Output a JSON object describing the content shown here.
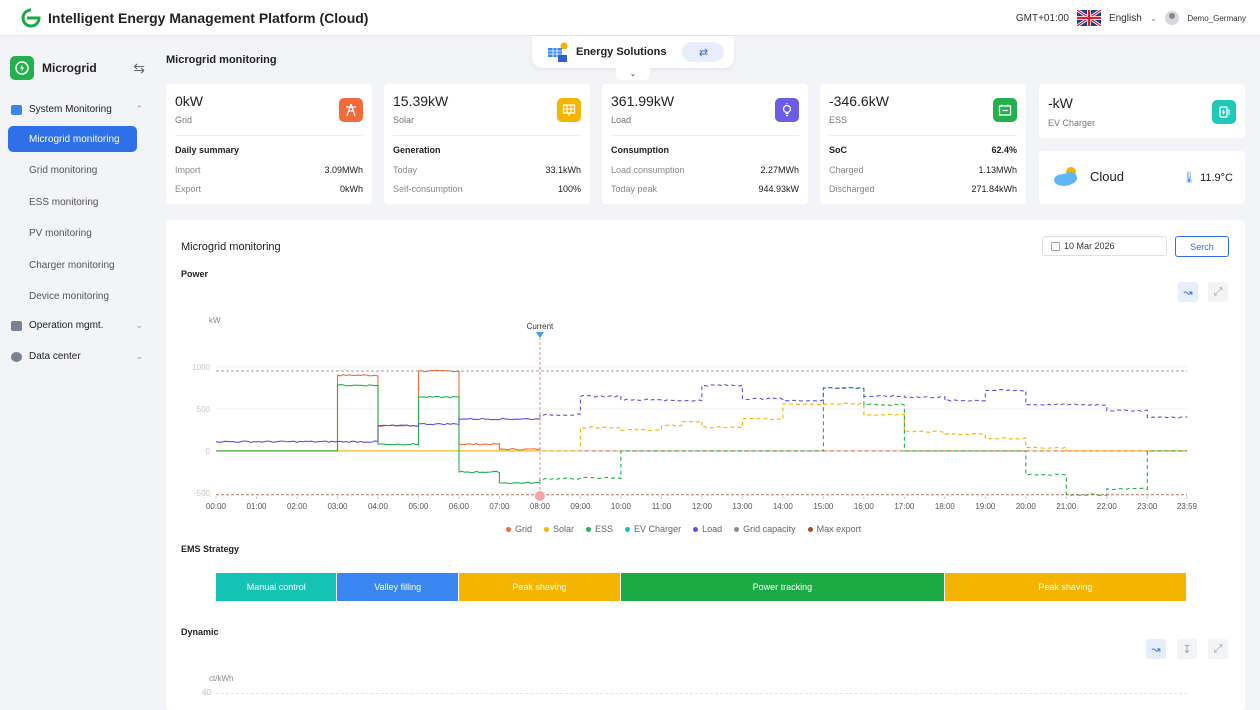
{
  "app": {
    "title": "Intelligent Energy Management Platform (Cloud)"
  },
  "topbar": {
    "timezone": "GMT+01:00",
    "language": "English",
    "user": "Demo_Germany"
  },
  "sidebar": {
    "title": "Microgrid",
    "groups": [
      {
        "label": "System Monitoring",
        "expanded": true
      },
      {
        "label": "Operation mgmt.",
        "expanded": false
      },
      {
        "label": "Data center",
        "expanded": false
      }
    ],
    "items": [
      {
        "label": "Microgrid monitoring",
        "active": true
      },
      {
        "label": "Grid monitoring"
      },
      {
        "label": "ESS monitoring"
      },
      {
        "label": "PV monitoring"
      },
      {
        "label": "Charger monitoring"
      },
      {
        "label": "Device monitoring"
      }
    ]
  },
  "main": {
    "page_title": "Microgrid monitoring",
    "energy_solutions": {
      "label": "Energy Solutions"
    },
    "cards": [
      {
        "value": "0kW",
        "label": "Grid",
        "section": "Daily summary",
        "icon": "grid-tower-icon",
        "color": "#f26b3a",
        "rows": [
          {
            "k": "Import",
            "v": "3.09MWh"
          },
          {
            "k": "Export",
            "v": "0kWh"
          }
        ]
      },
      {
        "value": "15.39kW",
        "label": "Solar",
        "section": "Generation",
        "icon": "solar-panel-icon",
        "color": "#f5b400",
        "rows": [
          {
            "k": "Today",
            "v": "33.1kWh"
          },
          {
            "k": "Self-consumption",
            "v": "100%"
          }
        ]
      },
      {
        "value": "361.99kW",
        "label": "Load",
        "section": "Consumption",
        "icon": "light-bulb-icon",
        "color": "#6c5ce7",
        "rows": [
          {
            "k": "Load consumption",
            "v": "2.27MWh"
          },
          {
            "k": "Today peak",
            "v": "944.93kW"
          }
        ]
      },
      {
        "value": "-346.6kW",
        "label": "ESS",
        "section": "SoC",
        "section_value": "62.4%",
        "icon": "battery-icon",
        "color": "#22b14c",
        "rows": [
          {
            "k": "Charged",
            "v": "1.13MWh"
          },
          {
            "k": "Discharged",
            "v": "271.84kWh"
          }
        ]
      },
      {
        "value": "-kW",
        "label": "EV Charger",
        "icon": "ev-charger-icon",
        "color": "#1fc8b8"
      }
    ],
    "weather": {
      "condition": "Cloud",
      "temperature": "11.9°C"
    },
    "panel": {
      "title": "Microgrid monitoring",
      "date": "10 Mar 2026",
      "search_label": "Serch",
      "power_label": "Power",
      "ems_label": "EMS Strategy",
      "dynamic_label": "Dynamic",
      "dynamic_unit": "ct/kWh",
      "dynamic_tick": "40"
    }
  },
  "chart_data": {
    "type": "line",
    "ylabel": "kW",
    "x": [
      "00:00",
      "01:00",
      "02:00",
      "03:00",
      "04:00",
      "05:00",
      "06:00",
      "07:00",
      "08:00",
      "09:00",
      "10:00",
      "11:00",
      "12:00",
      "13:00",
      "14:00",
      "15:00",
      "16:00",
      "17:00",
      "18:00",
      "19:00",
      "20:00",
      "21:00",
      "22:00",
      "23:00",
      "23:59"
    ],
    "ylim": [
      -500,
      1200
    ],
    "y_ticks": [
      "1000",
      "500",
      "0",
      "-500"
    ],
    "marker": {
      "label": "Current",
      "x": "08:00"
    },
    "series": [
      {
        "name": "Grid",
        "color": "#f26b3a",
        "steps": [
          [
            0,
            0
          ],
          [
            3,
            900
          ],
          [
            4,
            300
          ],
          [
            5,
            950
          ],
          [
            6,
            80
          ],
          [
            7,
            20
          ],
          [
            8,
            0
          ],
          [
            20,
            0
          ]
        ]
      },
      {
        "name": "Solar",
        "color": "#f5b400",
        "steps": [
          [
            0,
            0
          ],
          [
            8,
            0
          ],
          [
            9,
            280
          ],
          [
            10,
            250
          ],
          [
            11,
            300
          ],
          [
            11.5,
            350
          ],
          [
            12,
            280
          ],
          [
            13,
            380
          ],
          [
            14,
            560
          ],
          [
            15,
            560
          ],
          [
            16,
            430
          ],
          [
            17,
            230
          ],
          [
            18,
            200
          ],
          [
            19,
            150
          ],
          [
            20,
            40
          ],
          [
            21,
            0
          ],
          [
            23.98,
            0
          ]
        ]
      },
      {
        "name": "ESS",
        "color": "#22b14c",
        "steps": [
          [
            0,
            0
          ],
          [
            3,
            780
          ],
          [
            4,
            80
          ],
          [
            5,
            640
          ],
          [
            6,
            -250
          ],
          [
            7,
            -380
          ],
          [
            8,
            -330
          ],
          [
            9,
            -320
          ],
          [
            10,
            0
          ],
          [
            15,
            750
          ],
          [
            16,
            550
          ],
          [
            17,
            0
          ],
          [
            20,
            -280
          ],
          [
            21,
            -520
          ],
          [
            22,
            -450
          ],
          [
            23,
            0
          ],
          [
            23.98,
            0
          ]
        ]
      },
      {
        "name": "EV Charger",
        "color": "#1fb8c8",
        "steps": [
          [
            0,
            0
          ],
          [
            23.98,
            0
          ]
        ]
      },
      {
        "name": "Load",
        "color": "#5a55e0",
        "steps": [
          [
            0,
            110
          ],
          [
            3,
            110
          ],
          [
            4,
            300
          ],
          [
            5,
            320
          ],
          [
            6,
            380
          ],
          [
            8,
            430
          ],
          [
            9,
            650
          ],
          [
            10,
            610
          ],
          [
            11,
            600
          ],
          [
            12,
            780
          ],
          [
            13,
            620
          ],
          [
            14,
            600
          ],
          [
            15,
            750
          ],
          [
            16,
            650
          ],
          [
            17,
            640
          ],
          [
            18,
            600
          ],
          [
            19,
            720
          ],
          [
            20,
            550
          ],
          [
            22,
            480
          ],
          [
            23,
            400
          ],
          [
            23.98,
            400
          ]
        ]
      },
      {
        "name": "Grid capacity",
        "color": "#8a8a8a",
        "steps": [
          [
            0,
            950
          ],
          [
            23.98,
            950
          ]
        ]
      },
      {
        "name": "Max export",
        "color": "#a0522d",
        "steps": [
          [
            0,
            -520
          ],
          [
            23.98,
            -520
          ]
        ]
      }
    ],
    "ems_strategy": [
      {
        "label": "Manual control",
        "start": 0,
        "end": 3,
        "color": "#14c3b4"
      },
      {
        "label": "Valley filling",
        "start": 3,
        "end": 6,
        "color": "#3a86f0"
      },
      {
        "label": "Peak shaving",
        "start": 6,
        "end": 10,
        "color": "#f5b400"
      },
      {
        "label": "Power tracking",
        "start": 10,
        "end": 18,
        "color": "#1aab45"
      },
      {
        "label": "Peak shaving",
        "start": 18,
        "end": 23.98,
        "color": "#f5b400"
      }
    ]
  }
}
